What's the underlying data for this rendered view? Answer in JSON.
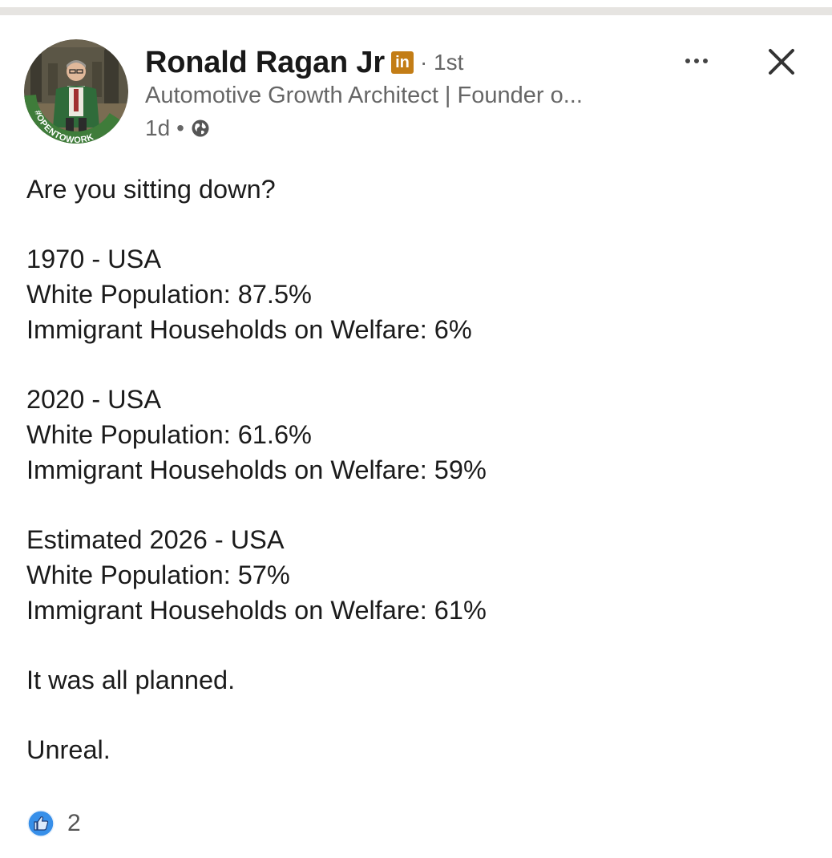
{
  "post": {
    "author": {
      "name": "Ronald Ragan Jr",
      "linkedin_badge": "in",
      "degree": "· 1st",
      "headline": "Automotive Growth Architect | Founder o...",
      "time": "1d",
      "meta_separator": "•",
      "avatar_frame_text": "#OPENTOWORK",
      "visibility_icon": "globe-icon",
      "badge_color": "#c37d16",
      "frame_color": "#3f7c3a"
    },
    "controls": {
      "more": "more-icon",
      "close": "close-icon"
    },
    "body": {
      "intro": "Are you sitting down?",
      "blocks": [
        {
          "heading": "1970 - USA",
          "white_population": "White Population: 87.5%",
          "welfare": "Immigrant Households on Welfare: 6%"
        },
        {
          "heading": "2020 - USA",
          "white_population": "White Population: 61.6%",
          "welfare": "Immigrant Households on Welfare: 59%"
        },
        {
          "heading": "Estimated 2026 - USA",
          "white_population": "White Population: 57%",
          "welfare": "Immigrant Households on Welfare: 61%"
        }
      ],
      "closing_1": "It was all planned.",
      "closing_2": "Unreal."
    },
    "reactions": {
      "icon": "like-icon",
      "count": "2",
      "color": "#378fe9"
    }
  }
}
